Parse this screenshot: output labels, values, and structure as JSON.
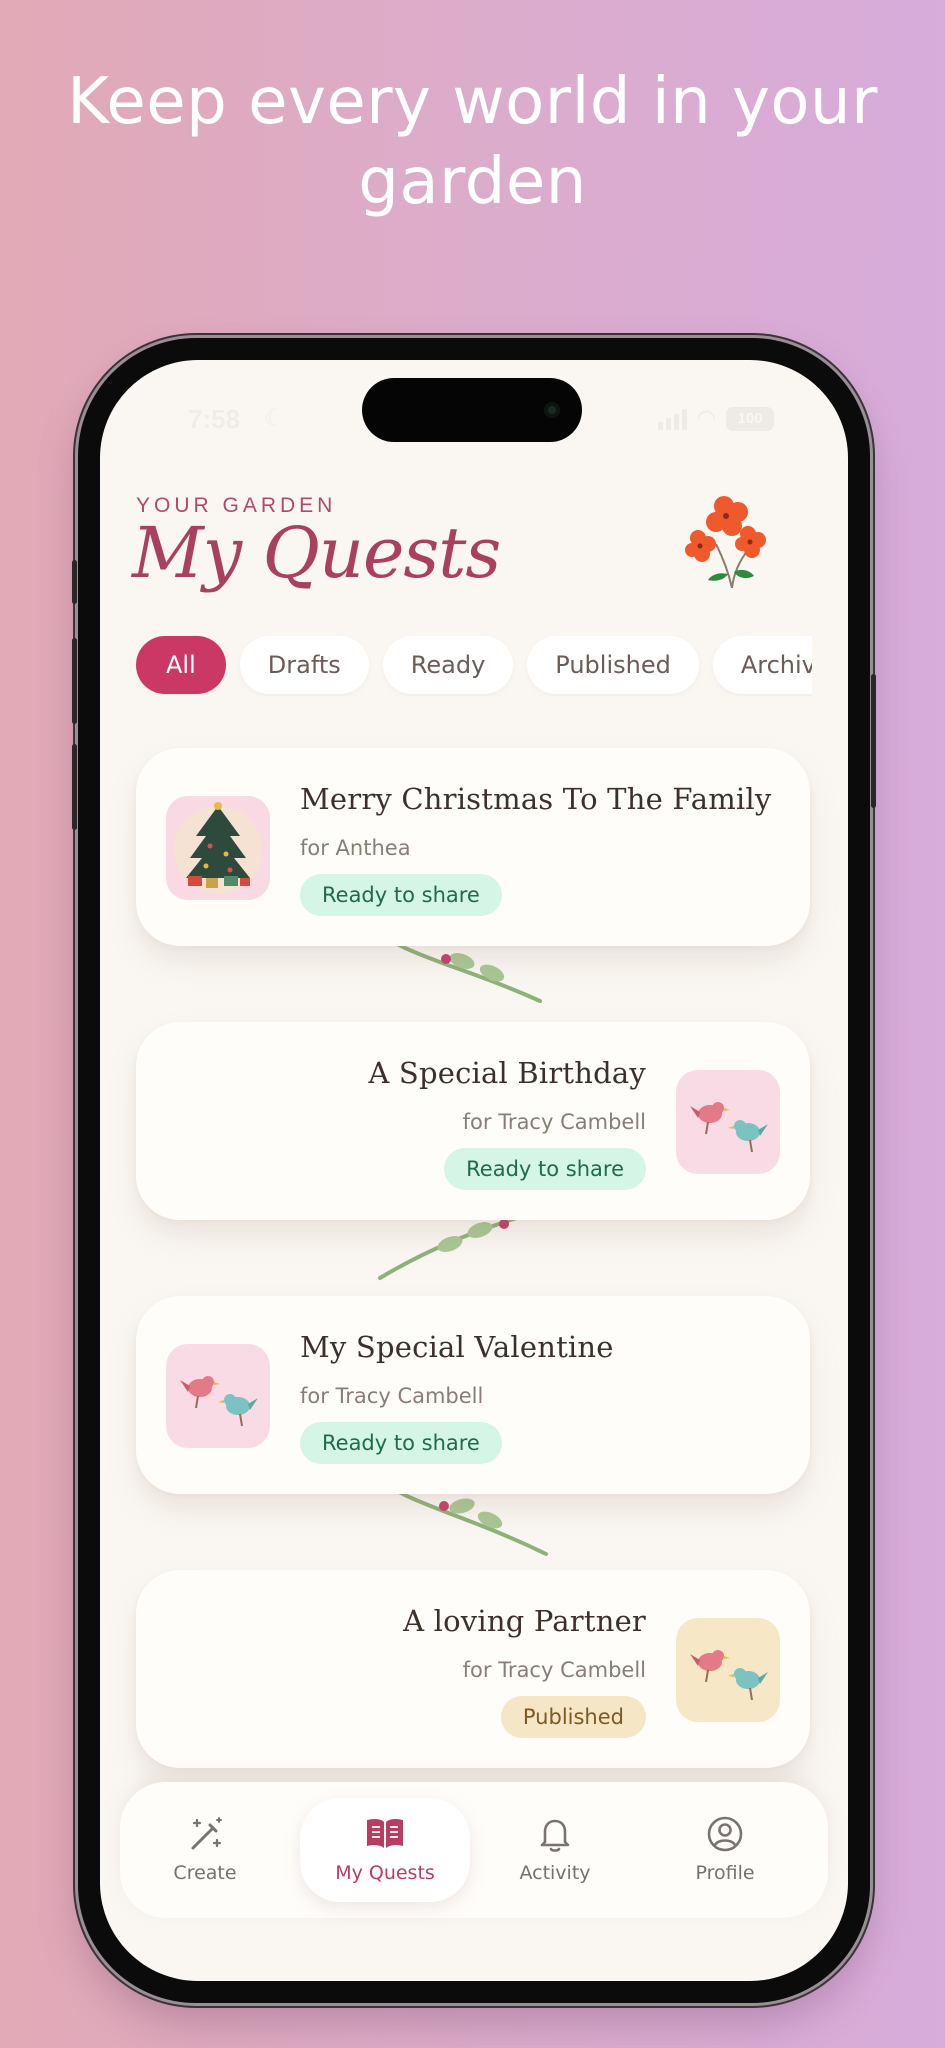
{
  "headline": "Keep every world in your garden",
  "status_bar": {
    "time": "7:58",
    "battery": "100"
  },
  "header": {
    "eyebrow": "YOUR GARDEN",
    "title": "My Quests"
  },
  "filters": [
    {
      "label": "All",
      "active": true
    },
    {
      "label": "Drafts",
      "active": false
    },
    {
      "label": "Ready",
      "active": false
    },
    {
      "label": "Published",
      "active": false
    },
    {
      "label": "Archived",
      "active": false
    }
  ],
  "quests": [
    {
      "title": "Merry Christmas To The Family",
      "recipient": "for Anthea",
      "status": "Ready to share",
      "status_type": "ready",
      "thumbnail": "christmas-tree-icon"
    },
    {
      "title": "A Special Birthday",
      "recipient": "for Tracy Cambell",
      "status": "Ready to share",
      "status_type": "ready",
      "thumbnail": "lovebirds-icon"
    },
    {
      "title": "My Special Valentine",
      "recipient": "for Tracy Cambell",
      "status": "Ready to share",
      "status_type": "ready",
      "thumbnail": "lovebirds-icon"
    },
    {
      "title": "A loving Partner",
      "recipient": "for Tracy Cambell",
      "status": "Published",
      "status_type": "published",
      "thumbnail": "lovebirds-icon"
    }
  ],
  "tabbar": {
    "create": "Create",
    "my_quests": "My Quests",
    "activity": "Activity",
    "profile": "Profile",
    "active": "my_quests"
  },
  "colors": {
    "accent": "#cc3866",
    "title": "#a9405f",
    "ready_bg": "#d5f5e6",
    "ready_text": "#1f6b4a",
    "published_bg": "#f5e6c6",
    "published_text": "#7c5a22",
    "vine": "#8fb27a"
  }
}
